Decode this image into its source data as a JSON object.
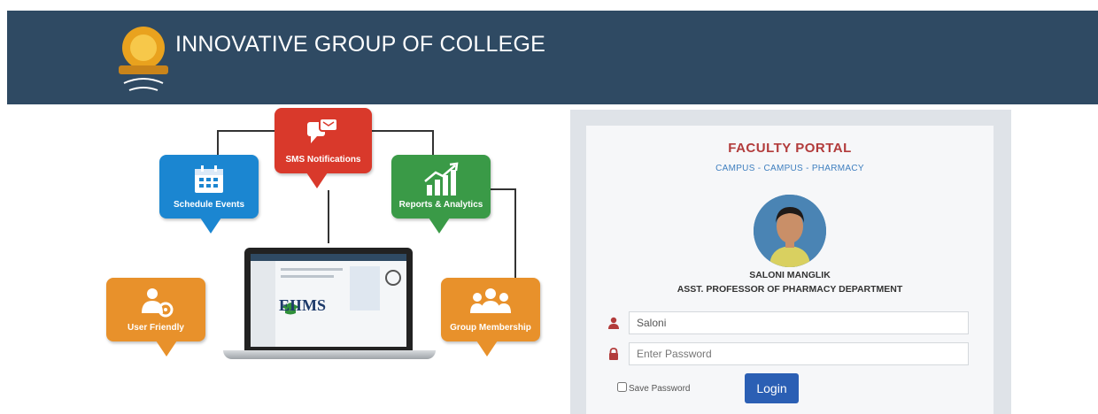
{
  "header": {
    "title": "INNOVATIVE GROUP OF COLLEGE",
    "logo_icon": "college-emblem-icon",
    "background": "#2f4a63"
  },
  "features": [
    {
      "label": "SMS Notifications",
      "icon": "chat-icon",
      "color": "#d9392b"
    },
    {
      "label": "Schedule Events",
      "icon": "calendar-icon",
      "color": "#1b86d1"
    },
    {
      "label": "Reports & Analytics",
      "icon": "bar-chart-icon",
      "color": "#3a9a47"
    },
    {
      "label": "User Friendly",
      "icon": "user-gear-icon",
      "color": "#e8912b"
    },
    {
      "label": "Group Membership",
      "icon": "users-group-icon",
      "color": "#e8912b"
    }
  ],
  "laptop": {
    "logo_text": "EIIMS"
  },
  "portal": {
    "title": "FACULTY PORTAL",
    "campus": "CAMPUS - CAMPUS - PHARMACY",
    "faculty_name": "SALONI MANGLIK",
    "faculty_role": "ASST. PROFESSOR OF PHARMACY DEPARTMENT",
    "username_value": "Saloni",
    "password_placeholder": "Enter Password",
    "save_password_label": "Save Password",
    "save_password_checked": false,
    "login_label": "Login",
    "accent": "#b23b3b",
    "button_color": "#2b5fb4"
  }
}
